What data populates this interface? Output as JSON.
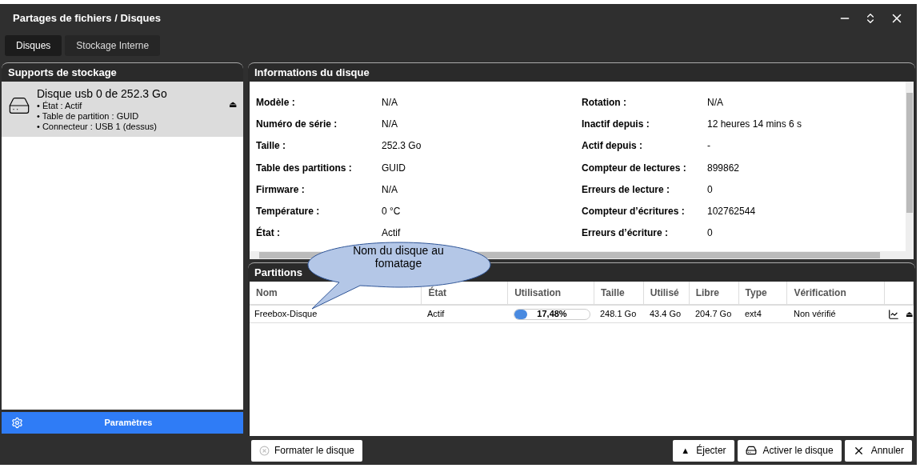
{
  "window": {
    "title": "Partages de fichiers / Disques"
  },
  "tabs": [
    {
      "label": "Disques",
      "selected": true
    },
    {
      "label": "Stockage Interne",
      "selected": false
    }
  ],
  "storage": {
    "title": "Supports de stockage",
    "items": [
      {
        "name": "Disque usb 0 de 252.3 Go",
        "details": [
          "• État : Actif",
          "• Table de partition : GUID",
          "• Connecteur : USB 1 (dessus)"
        ],
        "selected": true,
        "eject": "⏏"
      }
    ],
    "settings_button": "Paramètres"
  },
  "info": {
    "title": "Informations du disque",
    "left": [
      {
        "label": "Modèle :",
        "value": "N/A"
      },
      {
        "label": "Numéro de série :",
        "value": "N/A"
      },
      {
        "label": "Taille :",
        "value": "252.3 Go"
      },
      {
        "label": "Table des partitions :",
        "value": "GUID"
      },
      {
        "label": "Firmware :",
        "value": "N/A"
      },
      {
        "label": "Température :",
        "value": "0 °C"
      },
      {
        "label": "État :",
        "value": "Actif"
      }
    ],
    "right": [
      {
        "label": "Rotation :",
        "value": "N/A"
      },
      {
        "label": "Inactif depuis :",
        "value": "12 heures 14 mins 6 s"
      },
      {
        "label": "Actif depuis :",
        "value": "-"
      },
      {
        "label": "Compteur de lectures :",
        "value": "899862"
      },
      {
        "label": "Erreurs de lecture :",
        "value": "0"
      },
      {
        "label": "Compteur d’écritures :",
        "value": "102762544"
      },
      {
        "label": "Erreurs d’écriture :",
        "value": "0"
      }
    ]
  },
  "partitions": {
    "title": "Partitions",
    "columns": [
      "Nom",
      "État",
      "Utilisation",
      "Taille",
      "Utilisé",
      "Libre",
      "Type",
      "Vérification"
    ],
    "rows": [
      {
        "name": "Freebox-Disque",
        "state": "Actif",
        "usage": "17,48%",
        "level": 0.1748,
        "size": "248.1 Go",
        "used": "43.4 Go",
        "free": "204.7 Go",
        "type": "ext4",
        "check": "Non vérifié",
        "eject": "⏏"
      }
    ]
  },
  "callout": {
    "text": "Nom du disque au fomatage"
  },
  "footer": {
    "format_button": "Formater le disque",
    "buttons": [
      {
        "kind": "eject",
        "label": "Éjecter",
        "icon": "▲"
      },
      {
        "kind": "activate",
        "label": "Activer le disque"
      },
      {
        "kind": "cancel",
        "label": "Annuler"
      }
    ]
  }
}
